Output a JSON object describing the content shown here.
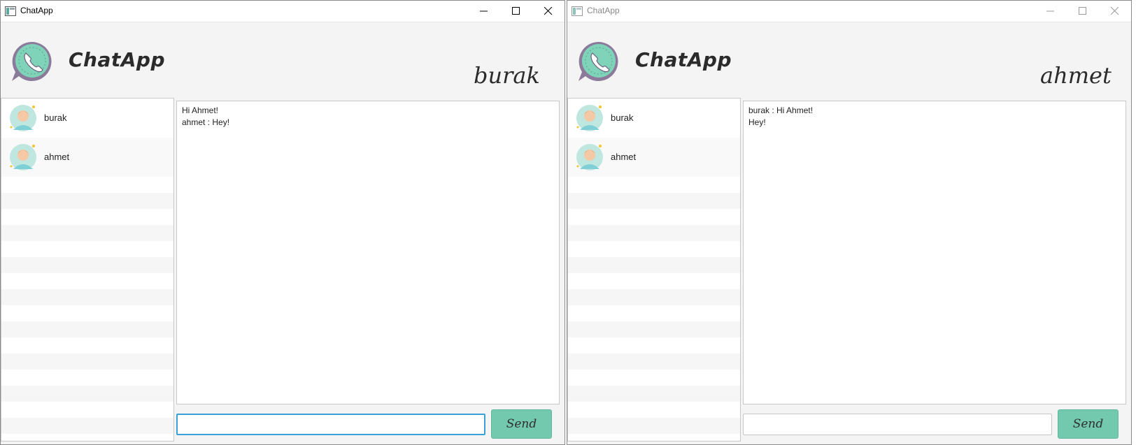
{
  "windows": [
    {
      "title": "ChatApp",
      "app_name": "ChatApp",
      "current_user": "burak",
      "active": true,
      "users": [
        {
          "name": "burak"
        },
        {
          "name": "ahmet"
        }
      ],
      "messages": [
        "Hi Ahmet!",
        "ahmet : Hey!"
      ],
      "input": {
        "value": "",
        "placeholder": ""
      },
      "send_label": "Send"
    },
    {
      "title": "ChatApp",
      "app_name": "ChatApp",
      "current_user": "ahmet",
      "active": false,
      "users": [
        {
          "name": "burak"
        },
        {
          "name": "ahmet"
        }
      ],
      "messages": [
        "burak : Hi Ahmet!",
        "Hey!"
      ],
      "input": {
        "value": "",
        "placeholder": ""
      },
      "send_label": "Send"
    }
  ],
  "colors": {
    "accent_green": "#72c9ae",
    "focus_blue": "#3aa0d8",
    "logo_green": "#7fd3b8"
  },
  "icons": [
    "app-window-icon",
    "minimize-icon",
    "maximize-icon",
    "close-icon",
    "whatsapp-phone-logo",
    "user-avatar-icon"
  ]
}
